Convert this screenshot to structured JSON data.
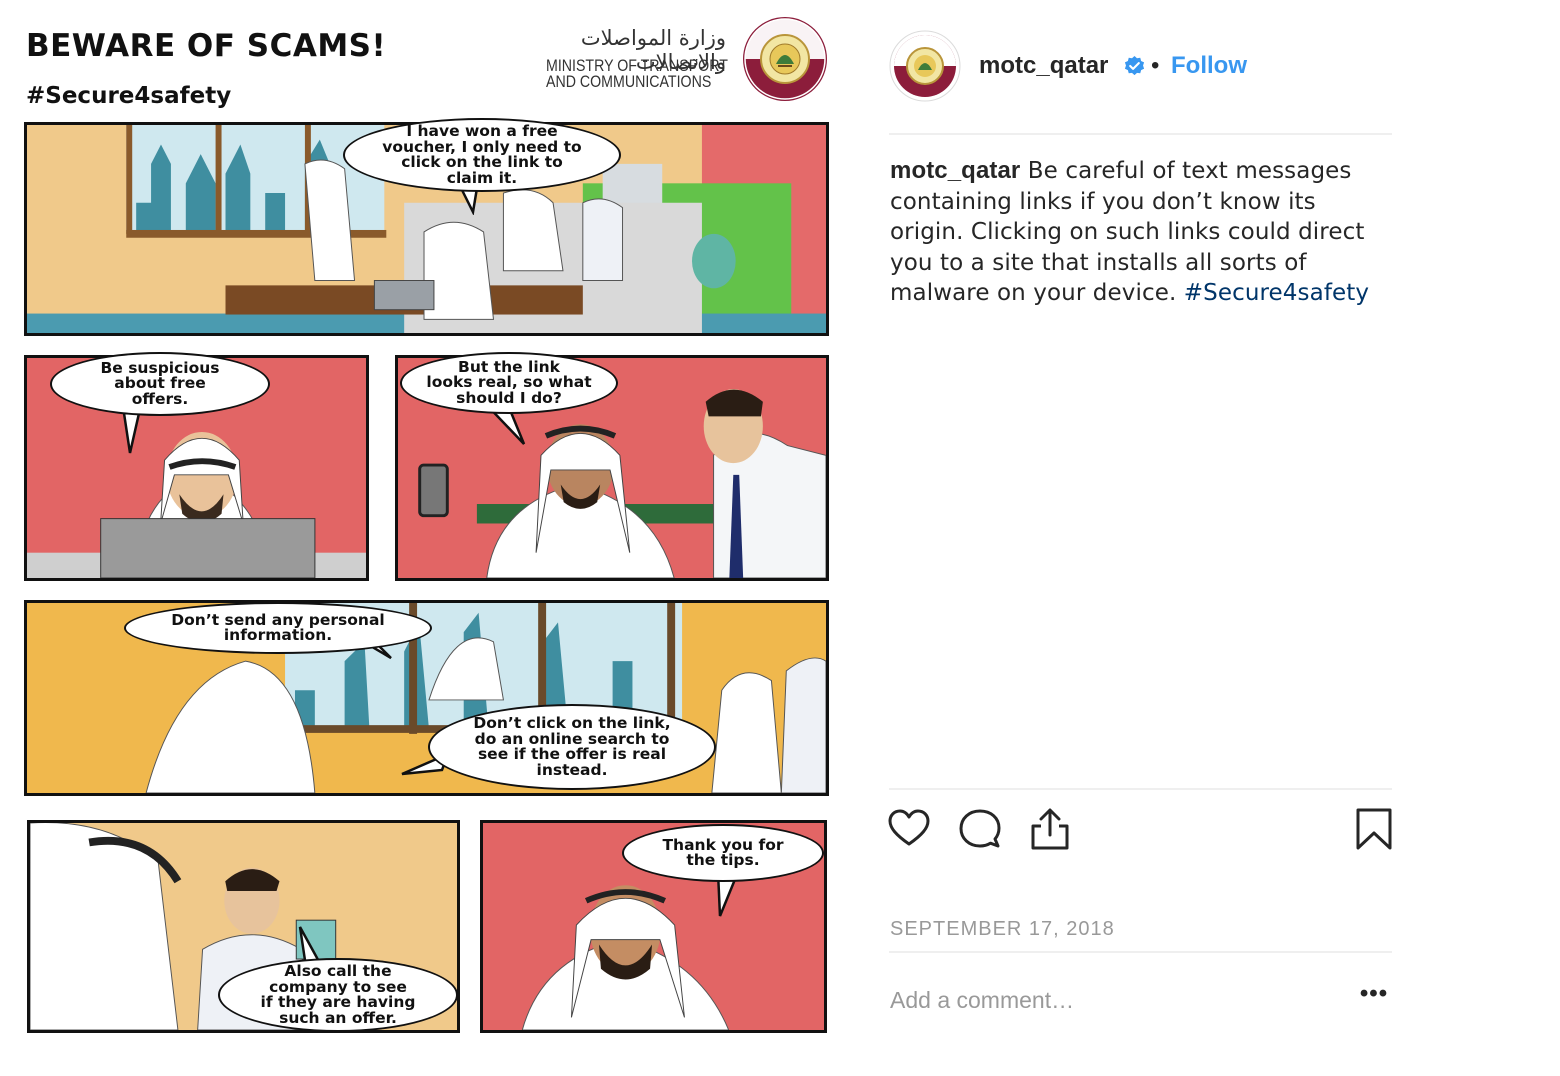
{
  "comic": {
    "title": "BEWARE OF SCAMS!",
    "hashtag": "#Secure4safety",
    "ministry_arabic": "وزارة المواصلات والاتصالات",
    "ministry_english_line1": "MINISTRY OF TRANSPORT",
    "ministry_english_line2": "AND COMMUNICATIONS",
    "bubbles": {
      "b1": [
        "I have won a free",
        "voucher, I only need to",
        "click on the link to",
        "claim it."
      ],
      "b2": [
        "Be suspicious",
        "about free",
        "offers."
      ],
      "b3": [
        "But the link",
        "looks real, so what",
        "should I do?"
      ],
      "b4": [
        "Don’t send any personal",
        "information."
      ],
      "b5": [
        "Don’t click on the link,",
        "do an online search to",
        "see if the offer is real",
        "instead."
      ],
      "b6": [
        "Also call the",
        "company to see",
        "if they are having",
        "such an offer."
      ],
      "b7": [
        "Thank you for",
        "the tips."
      ]
    }
  },
  "post": {
    "username": "motc_qatar",
    "separator": "•",
    "follow_label": "Follow",
    "caption_username": "motc_qatar",
    "caption_text": " Be careful of text messages containing links if you don’t know its origin. Clicking on such links could direct you to a site that installs all sorts of malware on your device. ",
    "caption_hashtag": "#Secure4safety",
    "date": "SEPTEMBER 17, 2018",
    "comment_placeholder": "Add a comment…",
    "more_label": "•••",
    "icons": {
      "like": "heart-icon",
      "comment": "comment-icon",
      "share": "share-icon",
      "save": "bookmark-icon",
      "verified": "verified-badge-icon"
    },
    "colors": {
      "follow": "#3897f0",
      "hashtag": "#003569",
      "verified": "#3897f0"
    }
  }
}
